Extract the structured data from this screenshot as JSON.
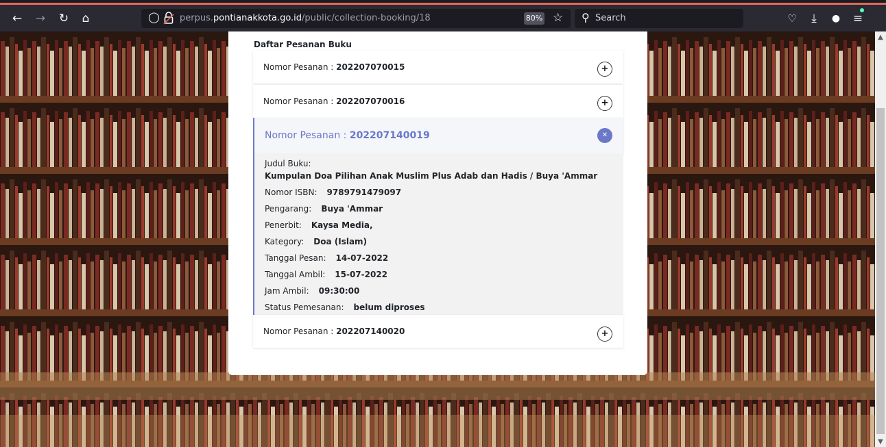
{
  "browser": {
    "url_prefix": "perpus.",
    "url_domain": "pontianakkota.go.id",
    "url_path": "/public/collection-booking/18",
    "zoom": "80%",
    "search_placeholder": "Search",
    "nav_icons": [
      "back-arrow-icon",
      "forward-arrow-icon",
      "reload-icon",
      "home-icon"
    ],
    "toolbar_icons": [
      "pocket-icon",
      "download-icon",
      "extension-icon",
      "menu-icon"
    ]
  },
  "colors": {
    "accent": "#6a78c8",
    "page_bg": "#3a2216",
    "chrome": "#2b2a33"
  },
  "bookings": {
    "title": "Daftar Pesanan Buku",
    "order_label": "Nomor Pesanan :",
    "items": [
      {
        "order_no": "202207070015",
        "expanded": false
      },
      {
        "order_no": "202207070016",
        "expanded": false
      },
      {
        "order_no": "202207140019",
        "expanded": true
      },
      {
        "order_no": "202207140020",
        "expanded": false
      }
    ],
    "detail": {
      "book_title_label": "Judul Buku:",
      "book_title": "Kumpulan Doa Pilihan Anak Muslim Plus Adab dan Hadis / Buya 'Ammar",
      "isbn_label": "Nomor ISBN:",
      "isbn": "9789791479097",
      "author_label": "Pengarang:",
      "author": "Buya 'Ammar",
      "publisher_label": "Penerbit:",
      "publisher": "Kaysa Media,",
      "category_label": "Kategory:",
      "category": "Doa (Islam)",
      "order_date_label": "Tanggal Pesan:",
      "order_date": "14-07-2022",
      "pickup_date_label": "Tanggal Ambil:",
      "pickup_date": "15-07-2022",
      "pickup_time_label": "Jam Ambil:",
      "pickup_time": "09:30:00",
      "status_label": "Status Pemesanan:",
      "status": "belum diproses"
    }
  }
}
